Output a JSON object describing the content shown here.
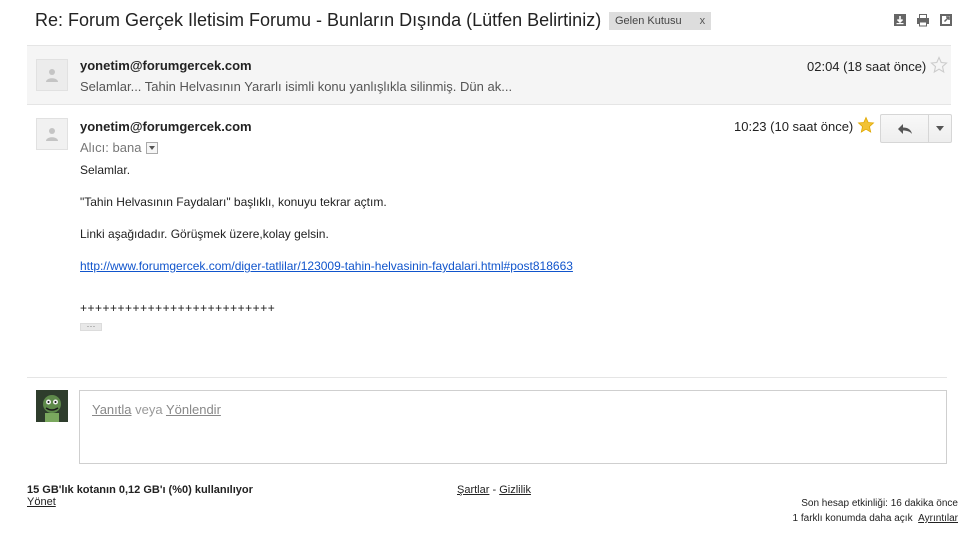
{
  "thread": {
    "subject": "Re: Forum Gerçek Iletisim Forumu - Bunların Dışında (Lütfen Belirtiniz)",
    "label": "Gelen Kutusu",
    "label_close": "x"
  },
  "toolbar_icons": [
    "download-icon",
    "print-icon",
    "new-window-icon"
  ],
  "messages": [
    {
      "sender": "yonetim@forumgercek.com",
      "snippet": "Selamlar... Tahin Helvasının Yararlı isimli konu yanlışlıkla silinmiş. Dün ak...",
      "time": "02:04 (18 saat önce)",
      "starred": false
    },
    {
      "sender": "yonetim@forumgercek.com",
      "to_label": "Alıcı: bana",
      "time": "10:23 (10 saat önce)",
      "starred": true,
      "body": {
        "line1": "Selamlar.",
        "line2": "\"Tahin Helvasının Faydaları\" başlıklı, konuyu tekrar açtım.",
        "line3": "Linki aşağıdadır. Görüşmek üzere,kolay gelsin.",
        "link": "http://www.forumgercek.com/diger-tatlilar/123009-tahin-helvasinin-faydalari.html#post818663",
        "plusline": "++++++++++++++++++++++++++",
        "ellipsis": "···"
      }
    }
  ],
  "reply": {
    "reply_link": "Yanıtla",
    "or": " veya ",
    "forward_link": "Yönlendir"
  },
  "footer": {
    "quota": "15 GB'lık kotanın 0,12 GB'ı (%0) kullanılıyor",
    "manage": "Yönet",
    "terms": "Şartlar",
    "sep": " - ",
    "privacy": "Gizlilik",
    "last_activity": "Son hesap etkinliği: 16 dakika önce",
    "other_locations": "1 farklı konumda daha açık",
    "details": "Ayrıntılar"
  },
  "colors": {
    "link": "#1155cc",
    "star_on": "#f2c233",
    "star_off": "#cccccc"
  }
}
